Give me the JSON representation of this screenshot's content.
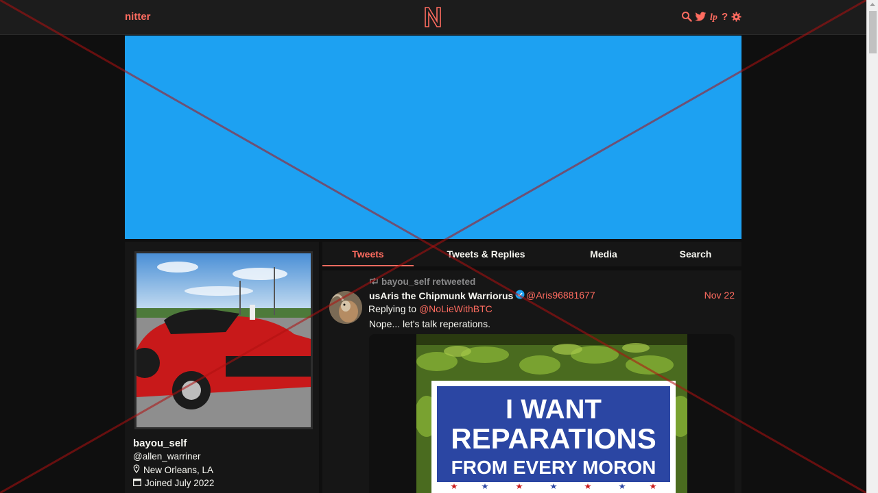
{
  "navbar": {
    "brand": "nitter",
    "logo_letter": "N",
    "icons": [
      "search-icon",
      "twitter-bird-icon",
      "liberapay-icon",
      "help-icon",
      "gear-icon"
    ]
  },
  "profile": {
    "fullname": "bayou_self",
    "username": "@allen_warriner",
    "location": "New Orleans, LA",
    "joined": "Joined July 2022"
  },
  "tabs": [
    "Tweets",
    "Tweets & Replies",
    "Media",
    "Search"
  ],
  "active_tab": "Tweets",
  "tweet": {
    "retweet_header": "bayou_self retweeted",
    "fullname": "usAris the Chipmunk Warriorus",
    "verified": true,
    "handle": "@Aris96881677",
    "date": "Nov 22",
    "replying_prefix": "Replying to",
    "replying_to": "@NoLieWithBTC",
    "text": "Nope... let's talk reperations.",
    "image_text": {
      "line1": "I WANT",
      "line2": "REPARATIONS",
      "line3": "FROM EVERY MORON"
    }
  },
  "colors": {
    "accent": "#ff6c60",
    "banner": "#1da1f2",
    "background": "#0f0f0f",
    "panel": "#161616"
  }
}
